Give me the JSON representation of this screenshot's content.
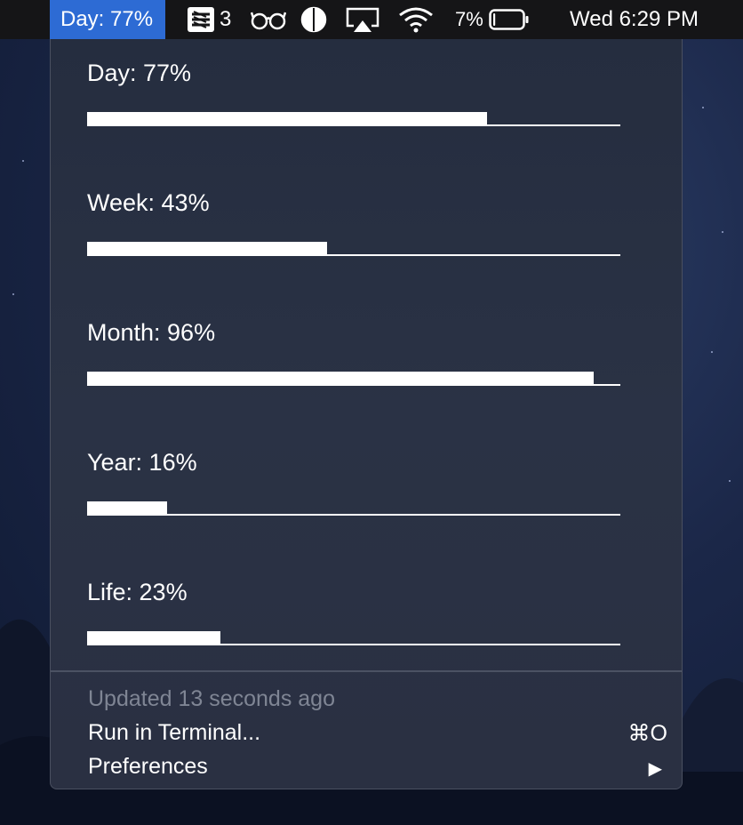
{
  "menubar": {
    "active_item": "Day: 77%",
    "todo_count": "3",
    "battery_percent": "7%",
    "battery_level": 0.07,
    "clock": "Wed 6:29 PM",
    "icons": [
      "stack-icon",
      "glasses-icon",
      "contrast-icon",
      "airplay-icon",
      "wifi-icon",
      "battery-icon"
    ]
  },
  "progress": [
    {
      "label": "Day: 77%",
      "value": 0.75
    },
    {
      "label": "Week: 43%",
      "value": 0.45
    },
    {
      "label": "Month: 96%",
      "value": 0.95
    },
    {
      "label": "Year: 16%",
      "value": 0.15
    },
    {
      "label": "Life: 23%",
      "value": 0.25
    }
  ],
  "footer": {
    "updated": "Updated 13 seconds ago",
    "run_label": "Run in Terminal...",
    "run_shortcut": "⌘O",
    "preferences_label": "Preferences",
    "preferences_arrow": "▶"
  },
  "colors": {
    "menubar_bg": "#151517",
    "active_highlight": "#2d6bd4",
    "panel_bg": "#272f42",
    "muted_text": "#7f8594"
  }
}
